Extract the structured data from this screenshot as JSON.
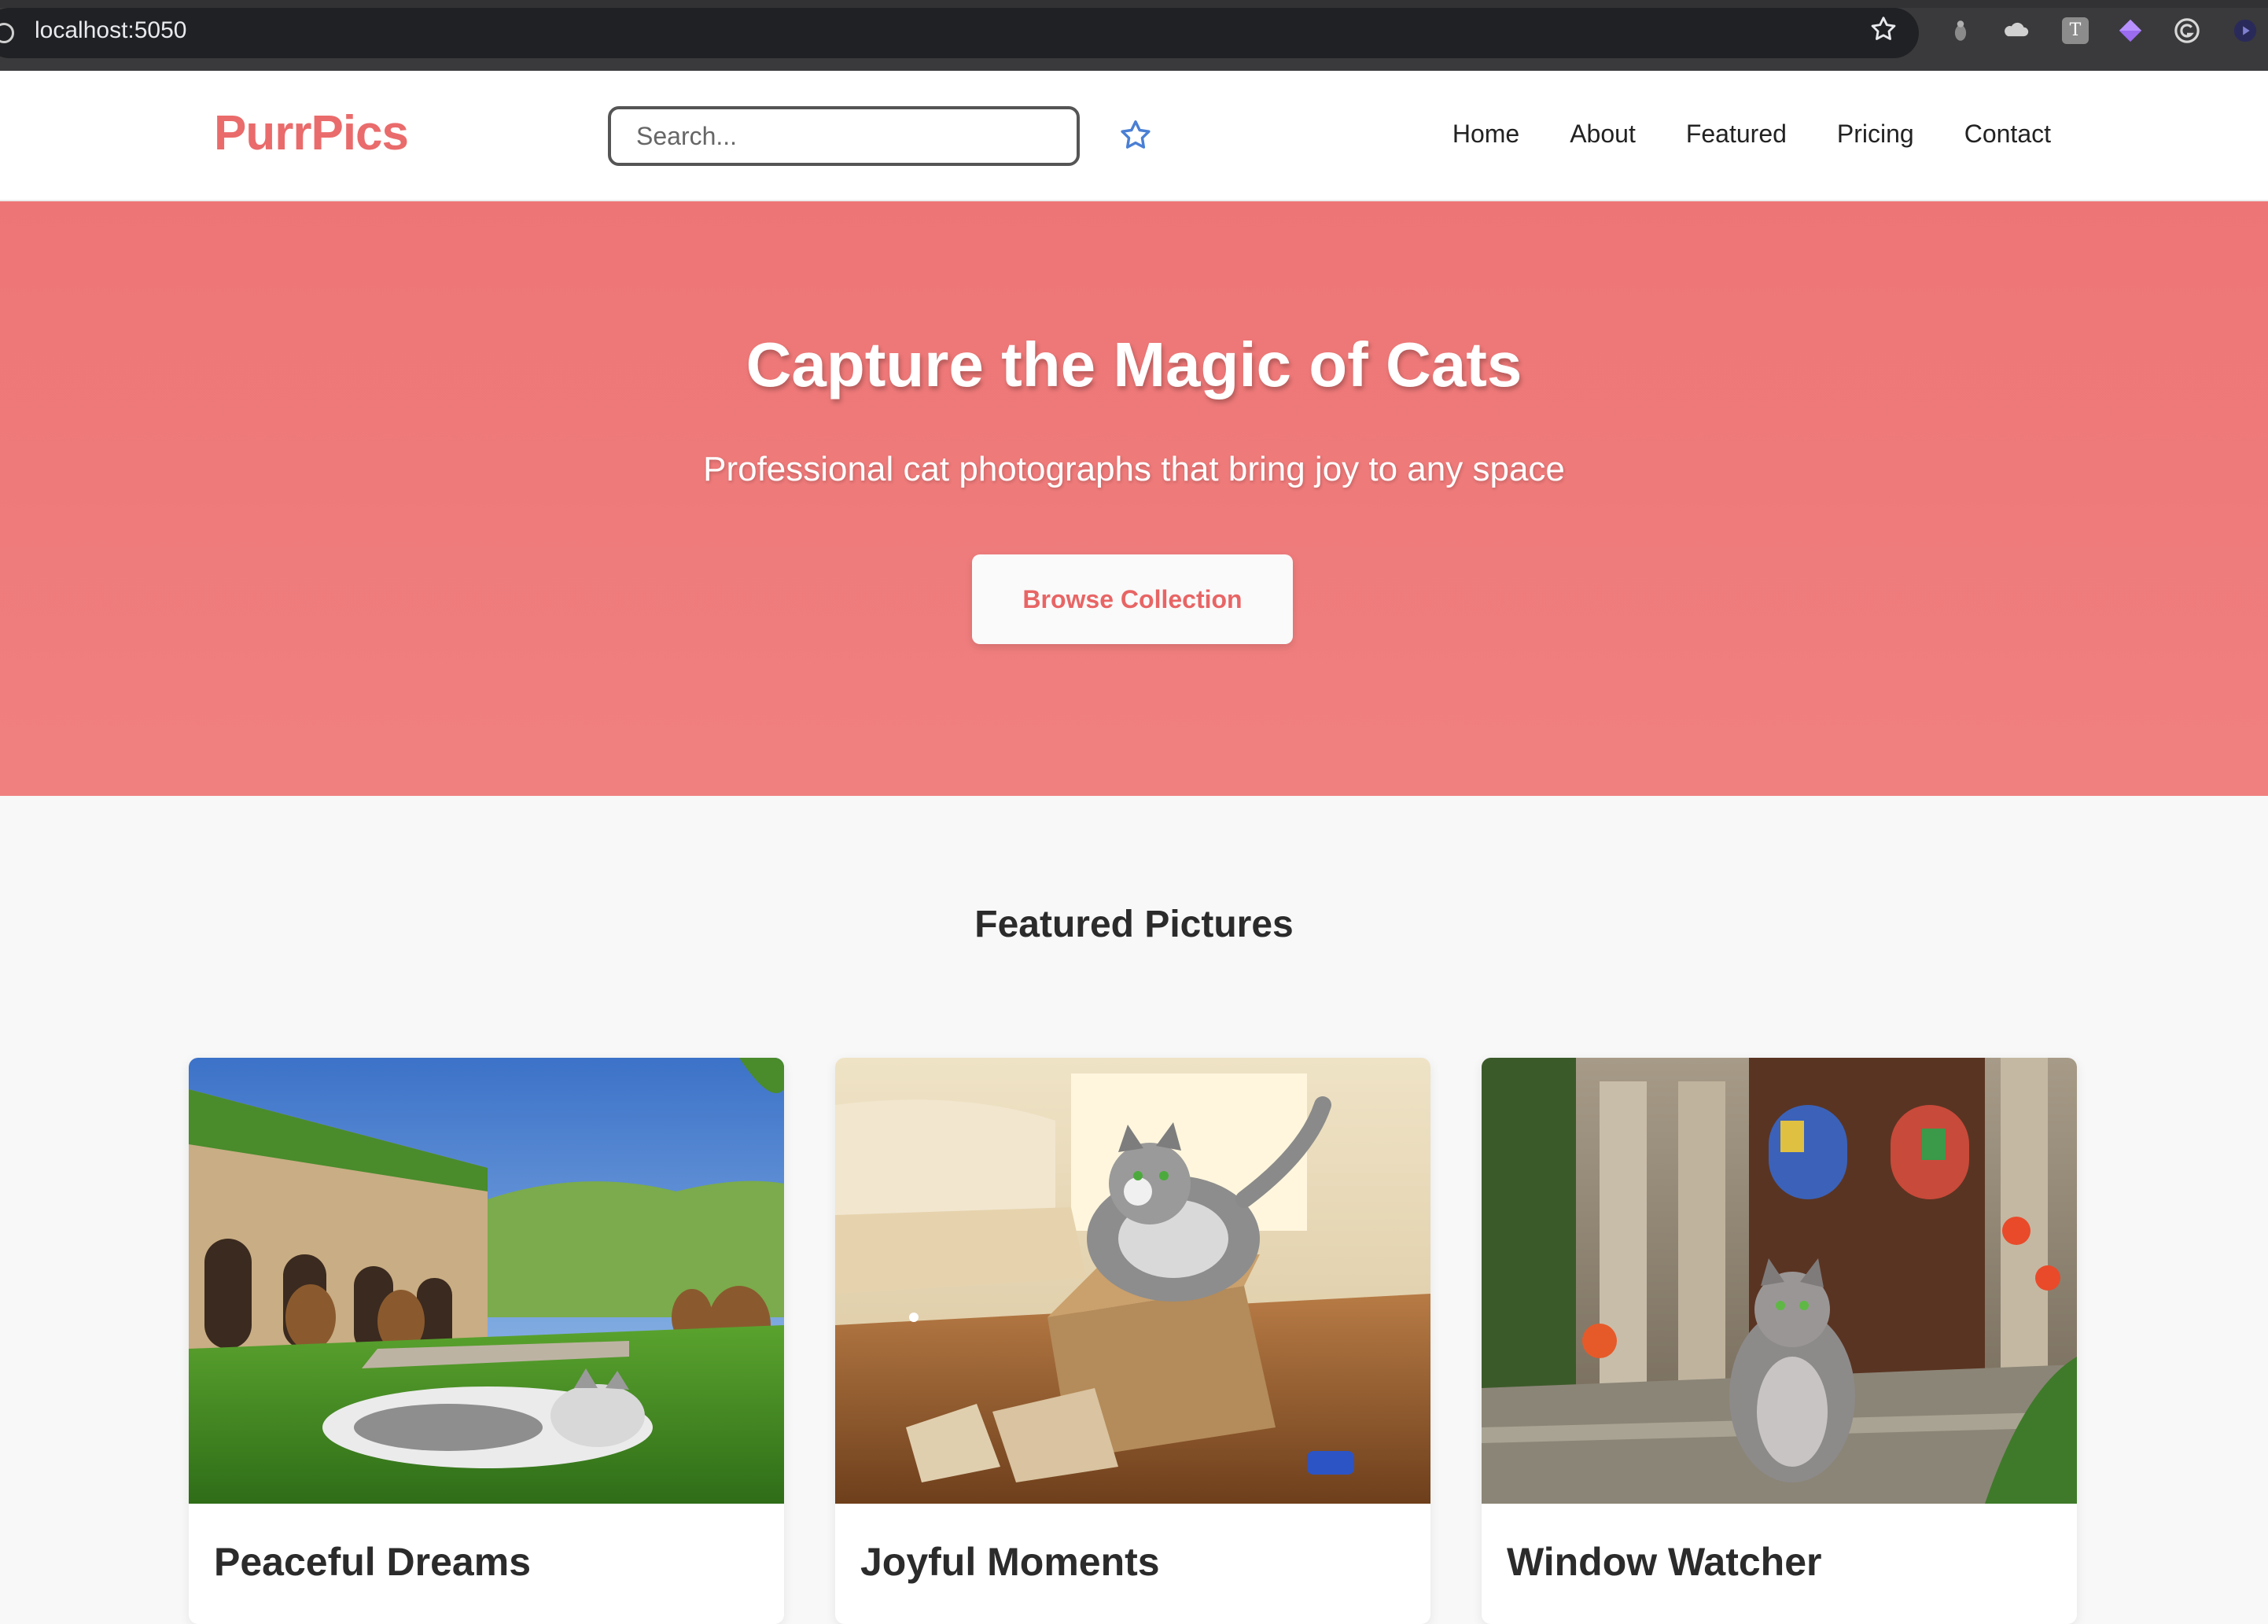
{
  "browser": {
    "url": "localhost:5050",
    "extension_t_label": "T"
  },
  "header": {
    "logo": "PurrPics",
    "search_placeholder": "Search...",
    "nav": [
      "Home",
      "About",
      "Featured",
      "Pricing",
      "Contact"
    ]
  },
  "hero": {
    "title": "Capture the Magic of Cats",
    "subtitle": "Professional cat photographs that bring joy to any space",
    "button": "Browse Collection"
  },
  "featured": {
    "title": "Featured Pictures",
    "cards": [
      {
        "title": "Peaceful Dreams",
        "image": "cat-sleeping-vineyard-courtyard"
      },
      {
        "title": "Joyful Moments",
        "image": "cat-playing-cardboard-box"
      },
      {
        "title": "Window Watcher",
        "image": "cat-sitting-cathedral-steps"
      }
    ]
  },
  "colors": {
    "brand": "#ea6b6b",
    "hero_bg": "#f08080",
    "star_blue": "#4a7fd4"
  }
}
